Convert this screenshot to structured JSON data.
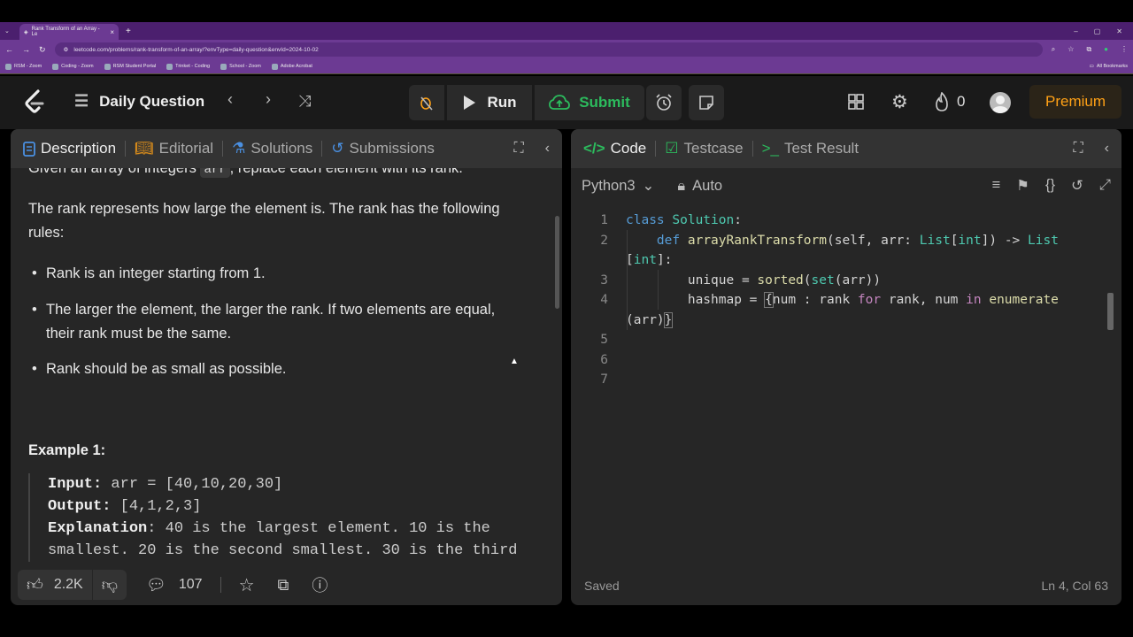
{
  "browser": {
    "tab_title": "Rank Transform of an Array - Le",
    "url": "leetcode.com/problems/rank-transform-of-an-array/?envType=daily-question&envId=2024-10-02",
    "bookmarks": [
      "RSM - Zoom",
      "Coding - Zoom",
      "RSM Student Portal",
      "Trinket - Coding",
      "School - Zoom",
      "Adobe Acrobat"
    ],
    "all_bookmarks": "All Bookmarks"
  },
  "header": {
    "daily_question": "Daily Question",
    "run": "Run",
    "submit": "Submit",
    "streak_count": "0",
    "premium": "Premium"
  },
  "left_panel": {
    "tabs": [
      "Description",
      "Editorial",
      "Solutions",
      "Submissions"
    ],
    "intro_start": "Given an array of integers ",
    "intro_code": "arr",
    "intro_end": ", replace each element with its rank.",
    "rank_line1": "The rank represents how large the element is. The rank has the following",
    "rank_line2": "rules:",
    "rules": [
      "Rank is an integer starting from 1.",
      "The larger the element, the larger the rank. If two elements are equal,",
      "their rank must be the same.",
      "Rank should be as small as possible."
    ],
    "example_title": "Example 1:",
    "input_label": "Input:",
    "input_value": " arr = [40,10,20,30]",
    "output_label": "Output:",
    "output_value": " [4,1,2,3]",
    "explanation_label": "Explanation",
    "explanation_line1": ": 40 is the largest element. 10 is the",
    "explanation_line2": "smallest. 20 is the second smallest. 30 is the third",
    "likes": "2.2K",
    "comments": "107"
  },
  "right_panel": {
    "tabs": [
      "Code",
      "Testcase",
      "Test Result"
    ],
    "language": "Python3",
    "mode": "Auto",
    "line_numbers": [
      "1",
      "2",
      "3",
      "4",
      "5",
      "6",
      "7"
    ],
    "status": "Saved",
    "cursor_position": "Ln 4, Col 63"
  }
}
